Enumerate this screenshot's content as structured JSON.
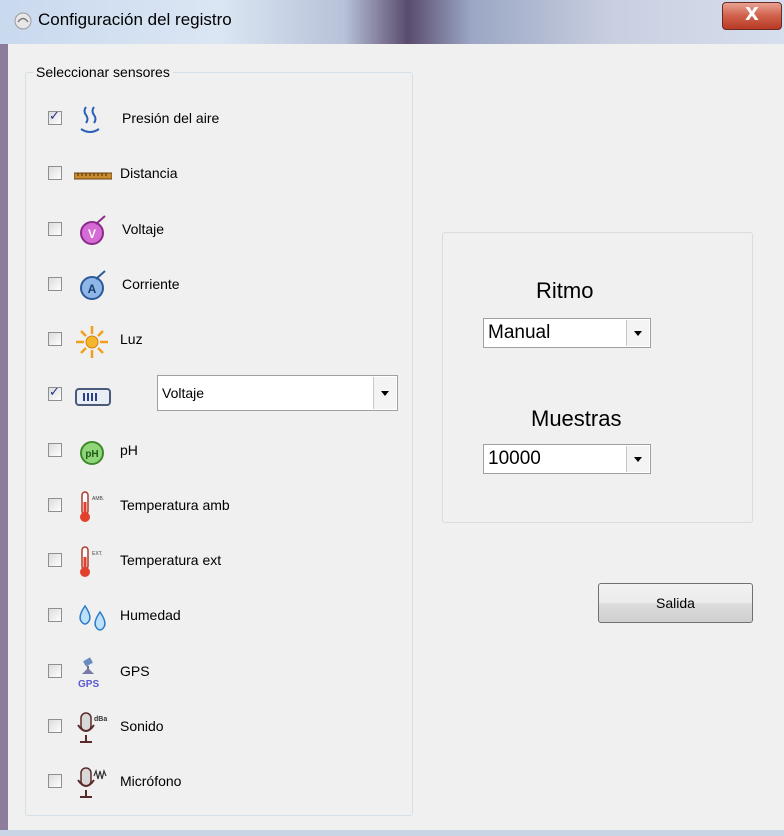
{
  "window": {
    "title": "Configuración del registro",
    "close_label": "X"
  },
  "sensors_group": {
    "label": "Seleccionar sensores",
    "items": [
      {
        "label": "Presión del aire",
        "checked": true,
        "icon": "air-pressure-icon"
      },
      {
        "label": "Distancia",
        "checked": false,
        "icon": "ruler-icon"
      },
      {
        "label": "Voltaje",
        "checked": false,
        "icon": "voltmeter-icon"
      },
      {
        "label": "Corriente",
        "checked": false,
        "icon": "ammeter-icon"
      },
      {
        "label": "Luz",
        "checked": false,
        "icon": "sun-icon"
      },
      {
        "label": "",
        "checked": true,
        "icon": "meter-icon",
        "select_value": "Voltaje"
      },
      {
        "label": "pH",
        "checked": false,
        "icon": "ph-icon"
      },
      {
        "label": "Temperatura amb",
        "checked": false,
        "icon": "thermometer-amb-icon"
      },
      {
        "label": "Temperatura ext",
        "checked": false,
        "icon": "thermometer-ext-icon"
      },
      {
        "label": "Humedad",
        "checked": false,
        "icon": "humidity-icon"
      },
      {
        "label": "GPS",
        "checked": false,
        "icon": "gps-icon"
      },
      {
        "label": "Sonido",
        "checked": false,
        "icon": "sound-mic-icon"
      },
      {
        "label": "Micrófono",
        "checked": false,
        "icon": "microphone-icon"
      }
    ]
  },
  "settings": {
    "ritmo_label": "Ritmo",
    "ritmo_value": "Manual",
    "muestras_label": "Muestras",
    "muestras_value": "10000"
  },
  "exit_button_label": "Salida",
  "icon_meta": {
    "amb_tag": "AMB.",
    "ext_tag": "EXT.",
    "gps_tag": "GPS",
    "dba_tag": "dBa",
    "volt_letter": "V",
    "amp_letter": "A",
    "ph_letter": "pH"
  },
  "colors": {
    "close_button": "#c9452f",
    "check_mark": "#24338c",
    "client_bg": "#f0f0f0"
  }
}
